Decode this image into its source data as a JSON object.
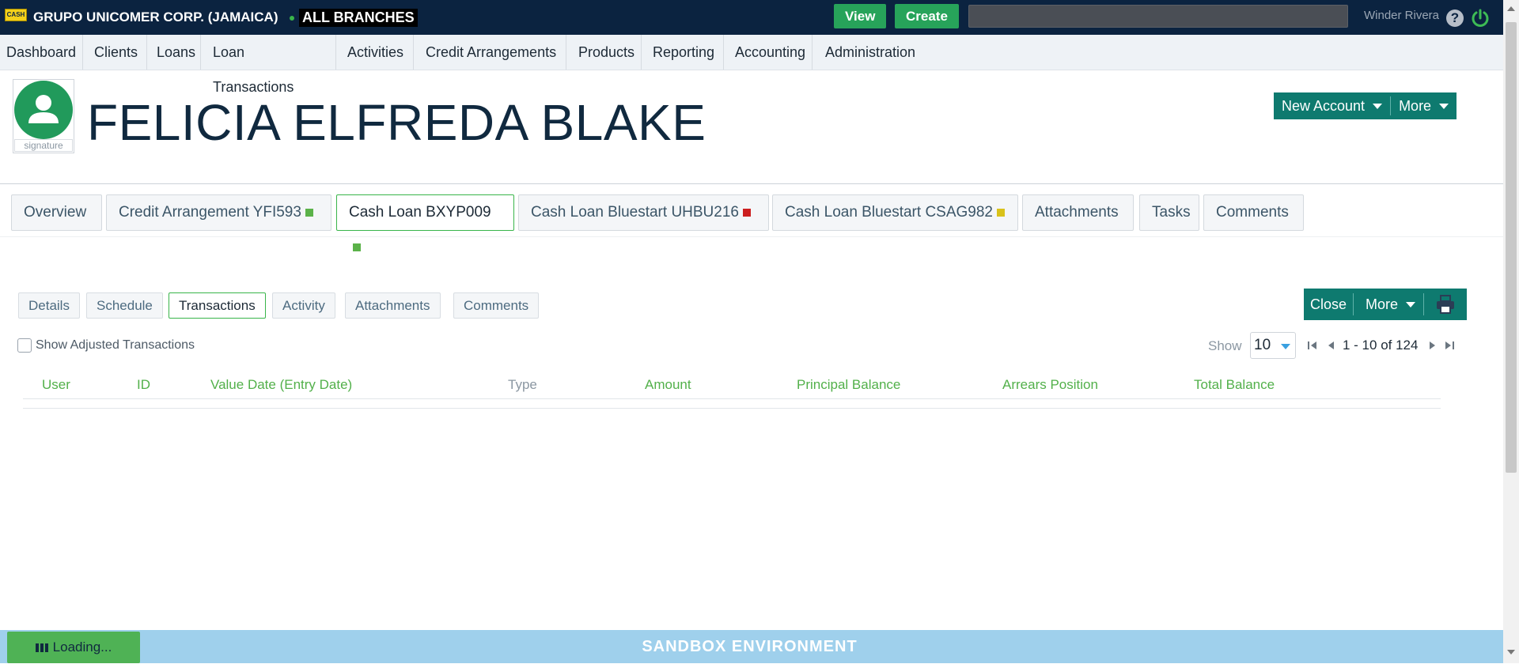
{
  "topbar": {
    "logo_text": "CASH",
    "org_name": "GRUPO UNICOMER CORP. (JAMAICA)",
    "branch": "ALL BRANCHES",
    "view_label": "View",
    "create_label": "Create",
    "user_name": "Winder Rivera",
    "help_icon": "?"
  },
  "nav": {
    "items": [
      "Dashboard",
      "Clients",
      "Loans",
      "Loan Transactions",
      "Activities",
      "Credit Arrangements",
      "Products",
      "Reporting",
      "Accounting",
      "Administration"
    ]
  },
  "client": {
    "name": "FELICIA ELFREDA BLAKE",
    "signature_label": "signature",
    "new_account_label": "New Account",
    "more_label": "More"
  },
  "account_tabs": [
    {
      "label": "Overview"
    },
    {
      "label": "Credit Arrangement YFI593",
      "status_color": "#5bb249"
    },
    {
      "label": "Cash Loan BXYP009",
      "status_color": "#5bb249"
    },
    {
      "label": "Cash Loan Bluestart UHBU216",
      "status_color": "#cc1f1f"
    },
    {
      "label": "Cash Loan Bluestart CSAG982",
      "status_color": "#d9c21a"
    },
    {
      "label": "Attachments"
    },
    {
      "label": "Tasks"
    },
    {
      "label": "Comments"
    }
  ],
  "sub_tabs": [
    "Details",
    "Schedule",
    "Transactions",
    "Activity",
    "Attachments",
    "Comments"
  ],
  "actions": {
    "close_label": "Close",
    "more_label": "More",
    "print_icon": "printer-icon"
  },
  "filter": {
    "show_adjusted_label": "Show Adjusted Transactions"
  },
  "pager": {
    "show_label": "Show",
    "page_size": "10",
    "range_text": "1 - 10 of 124"
  },
  "table": {
    "columns": [
      "User",
      "ID",
      "Value Date (Entry Date)",
      "Type",
      "Amount",
      "Principal Balance",
      "Arrears Position",
      "Total Balance"
    ]
  },
  "footer": {
    "loading_text": "Loading...",
    "environment_label": "SANDBOX ENVIRONMENT"
  }
}
